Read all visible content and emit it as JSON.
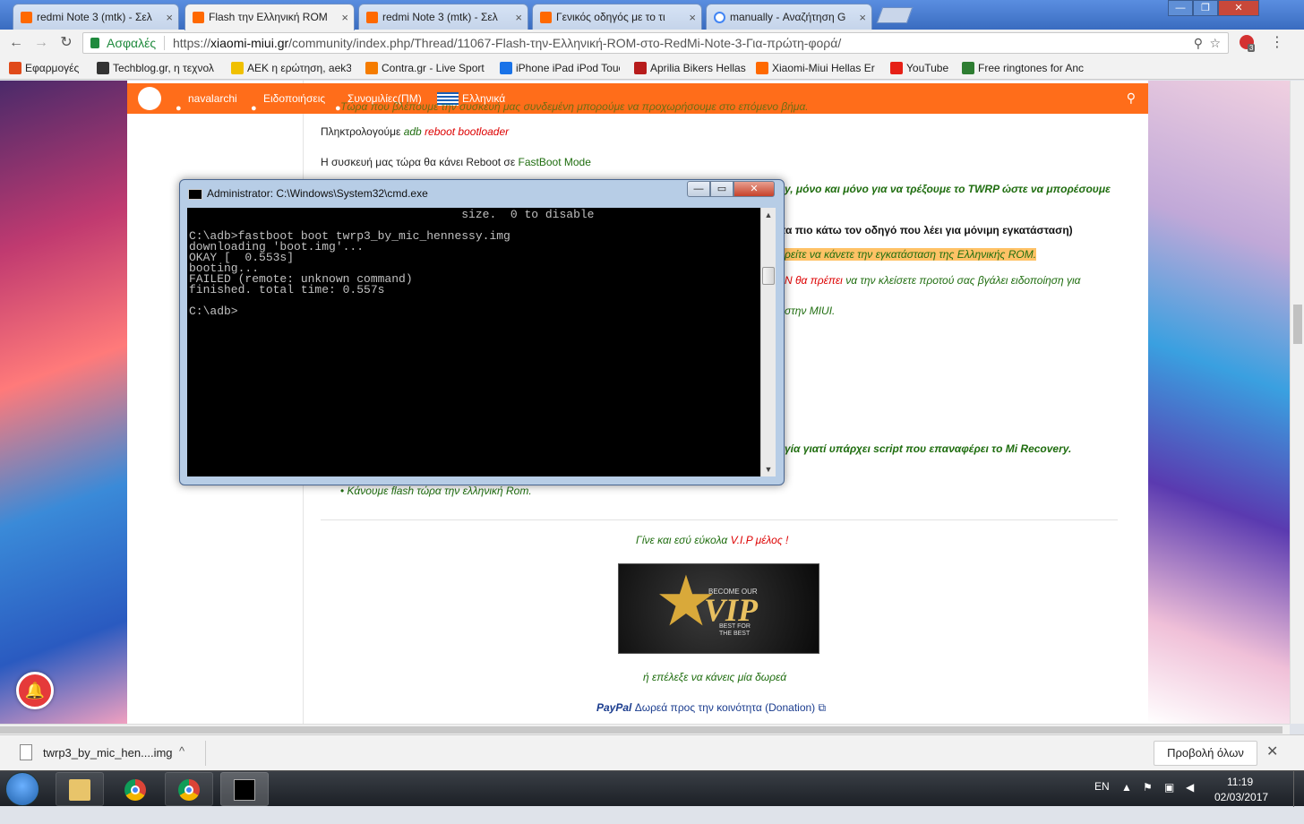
{
  "browser": {
    "tabs": [
      {
        "label": "redmi Note 3 (mtk) - Σελ",
        "icon": "xiaomi-favicon"
      },
      {
        "label": "Flash την Ελληνική ROM",
        "icon": "xiaomi-favicon",
        "active": true
      },
      {
        "label": "redmi Note 3 (mtk) - Σελ",
        "icon": "xiaomi-favicon"
      },
      {
        "label": "Γενικός οδηγός με το τι",
        "icon": "xiaomi-favicon"
      },
      {
        "label": "manually - Αναζήτηση G",
        "icon": "google-favicon"
      }
    ],
    "tab_close_glyph": "×",
    "window_controls": {
      "minimize": "—",
      "maximize": "❐",
      "close": "✕"
    },
    "nav": {
      "back": "←",
      "forward": "→",
      "reload": "↻"
    },
    "secure_label": "Ασφαλές",
    "url_prefix": "https://",
    "url_host": "xiaomi-miui.gr",
    "url_path": "/community/index.php/Thread/11067-Flash-την-Ελληνική-ROM-στο-RedMi-Note-3-Για-πρώτη-φορά/",
    "zoom_glyph": "⚲",
    "star_glyph": "☆",
    "extension_badge": "3",
    "menu_glyph": "⋮",
    "bookmarks": [
      {
        "label": "Εφαρμογές",
        "color": "#e04a1a"
      },
      {
        "label": "Techblog.gr, η τεχνολ",
        "color": "#333333"
      },
      {
        "label": "ΑΕΚ η ερώτηση, aek3",
        "color": "#f0c000"
      },
      {
        "label": "Contra.gr - Live Sport",
        "color": "#f57c00"
      },
      {
        "label": "iPhone iPad iPod Touc",
        "color": "#1a73e8"
      },
      {
        "label": "Aprilia Bikers Hellas",
        "color": "#b71c1c"
      },
      {
        "label": "Xiaomi-Miui Hellas Er",
        "color": "#ff6900"
      },
      {
        "label": "YouTube",
        "color": "#e62117"
      },
      {
        "label": "Free ringtones for Anc",
        "color": "#2e7d32"
      }
    ]
  },
  "site": {
    "nav": {
      "user": "navalarchi",
      "notifications": "Ειδοποιήσεις",
      "conversations": "Συνομιλίες(ΠΜ)",
      "language": "Ελληνικά",
      "search_glyph": "⚲"
    },
    "post": {
      "line_top": "Τώρα που βλέπουμε την συσκευή μας συνδεμένη μπορούμε να προχωρήσουμε στο επόμενο βήμα.",
      "type_intro": "Πληκτρολογούμε",
      "cmd_adb": "adb",
      "cmd_reboot": "reboot bootloader",
      "reboot_msg_prefix": "Η συσκευή μας τώρα θα κάνει Reboot σε",
      "reboot_msg_mode": "FastBoot Mode",
      "partial_1": "y, μόνο και μόνο για να τρέξουμε το TWRP ώστε να μπορέσουμε",
      "partial_2": "τα πιο κάτω τον οδηγό που λέει για μόνιμη εγκατάσταση)",
      "partial_3": "ρείτε να κάνετε την εγκατάσταση της Ελληνικής ROM.",
      "partial_4_red": "N θα πρέπει",
      "partial_4_green": "να την κλείσετε προτού σας βγάλει ειδοποίηση για",
      "partial_5": "στην MIUI.",
      "partial_6": "γία γιατί υπάρχει script που επαναφέρει το Mi Recovery.",
      "bullet_last": "Κάνουμε flash τώρα την ελληνική Rom.",
      "vip_prefix": "Γίνε και εσύ εύκολα",
      "vip_link": "V.I.P μέλος",
      "vip_suffix": "!",
      "vip_banner_become": "BECOME OUR",
      "vip_banner_word": "VIP",
      "vip_banner_best": "BEST FOR THE BEST",
      "donate_prompt": "ή επέλεξε να κάνεις μία δωρεά",
      "paypal": "PayPal",
      "donate_link": "Δωρεά προς την κοινότητα (Donation)",
      "external_glyph": "⧉"
    },
    "notification_glyph": "🔔"
  },
  "cmd": {
    "title": "Administrator: C:\\Windows\\System32\\cmd.exe",
    "controls": {
      "minimize": "—",
      "maximize": "▭",
      "close": "✕"
    },
    "lines": [
      "                                       size.  0 to disable",
      "",
      "C:\\adb>fastboot boot twrp3_by_mic_hennessy.img",
      "downloading 'boot.img'...",
      "OKAY [  0.553s]",
      "booting...",
      "FAILED (remote: unknown command)",
      "finished. total time: 0.557s",
      "",
      "C:\\adb>"
    ],
    "scroll_up": "▲",
    "scroll_down": "▼"
  },
  "downloads": {
    "file": "twrp3_by_mic_hen....img",
    "chevron": "^",
    "show_all": "Προβολή όλων",
    "close": "✕"
  },
  "taskbar": {
    "lang": "EN",
    "time": "11:19",
    "date": "02/03/2017"
  }
}
